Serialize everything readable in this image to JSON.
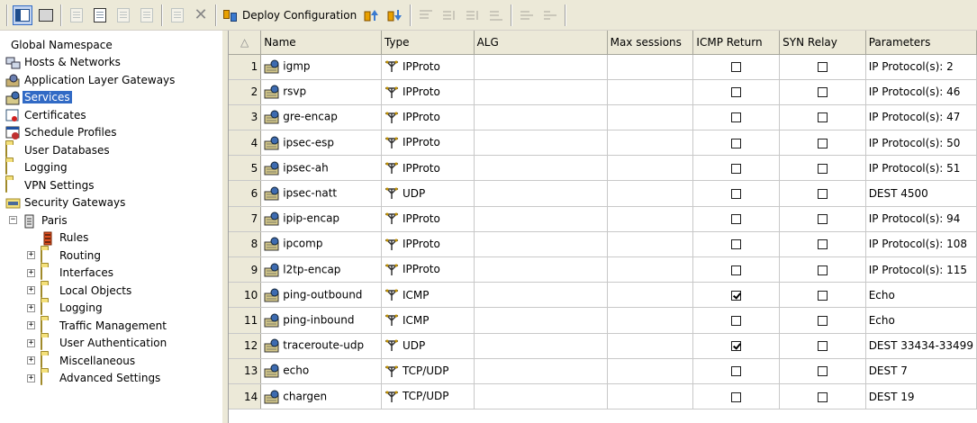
{
  "toolbar": {
    "deploy_label": "Deploy Configuration"
  },
  "tree": {
    "root": "Global Namespace",
    "items": [
      {
        "label": "Hosts & Networks",
        "icon": "hosts-networks-icon"
      },
      {
        "label": "Application Layer Gateways",
        "icon": "alg-icon"
      },
      {
        "label": "Services",
        "icon": "services-icon",
        "selected": true
      },
      {
        "label": "Certificates",
        "icon": "certificate-icon"
      },
      {
        "label": "Schedule Profiles",
        "icon": "schedule-icon"
      },
      {
        "label": "User Databases",
        "icon": "folder-icon"
      },
      {
        "label": "Logging",
        "icon": "folder-icon"
      },
      {
        "label": "VPN Settings",
        "icon": "folder-icon"
      },
      {
        "label": "Security Gateways",
        "icon": "gateway-folder-icon"
      }
    ],
    "gateway": "Paris",
    "gateway_children": [
      {
        "label": "Rules",
        "icon": "rules-icon",
        "expandable": false
      },
      {
        "label": "Routing",
        "icon": "folder-icon",
        "expandable": true
      },
      {
        "label": "Interfaces",
        "icon": "folder-icon",
        "expandable": true
      },
      {
        "label": "Local Objects",
        "icon": "folder-icon",
        "expandable": true
      },
      {
        "label": "Logging",
        "icon": "folder-icon",
        "expandable": true
      },
      {
        "label": "Traffic Management",
        "icon": "folder-icon",
        "expandable": true
      },
      {
        "label": "User Authentication",
        "icon": "folder-icon",
        "expandable": true
      },
      {
        "label": "Miscellaneous",
        "icon": "folder-icon",
        "expandable": true
      },
      {
        "label": "Advanced Settings",
        "icon": "folder-icon",
        "expandable": true
      }
    ],
    "expand_symbol": "+",
    "collapse_symbol": "−"
  },
  "table": {
    "sort_indicator": "△",
    "columns": [
      "Name",
      "Type",
      "ALG",
      "Max sessions",
      "ICMP Return",
      "SYN Relay",
      "Parameters"
    ],
    "rows": [
      {
        "n": "1",
        "name": "igmp",
        "type": "IPProto",
        "alg": "",
        "max": "",
        "icmp": false,
        "syn": false,
        "params": "IP Protocol(s): 2"
      },
      {
        "n": "2",
        "name": "rsvp",
        "type": "IPProto",
        "alg": "",
        "max": "",
        "icmp": false,
        "syn": false,
        "params": "IP Protocol(s): 46"
      },
      {
        "n": "3",
        "name": "gre-encap",
        "type": "IPProto",
        "alg": "",
        "max": "",
        "icmp": false,
        "syn": false,
        "params": "IP Protocol(s): 47"
      },
      {
        "n": "4",
        "name": "ipsec-esp",
        "type": "IPProto",
        "alg": "",
        "max": "",
        "icmp": false,
        "syn": false,
        "params": "IP Protocol(s): 50"
      },
      {
        "n": "5",
        "name": "ipsec-ah",
        "type": "IPProto",
        "alg": "",
        "max": "",
        "icmp": false,
        "syn": false,
        "params": "IP Protocol(s): 51"
      },
      {
        "n": "6",
        "name": "ipsec-natt",
        "type": "UDP",
        "alg": "",
        "max": "",
        "icmp": false,
        "syn": false,
        "params": "DEST 4500"
      },
      {
        "n": "7",
        "name": "ipip-encap",
        "type": "IPProto",
        "alg": "",
        "max": "",
        "icmp": false,
        "syn": false,
        "params": "IP Protocol(s): 94"
      },
      {
        "n": "8",
        "name": "ipcomp",
        "type": "IPProto",
        "alg": "",
        "max": "",
        "icmp": false,
        "syn": false,
        "params": "IP Protocol(s): 108"
      },
      {
        "n": "9",
        "name": "l2tp-encap",
        "type": "IPProto",
        "alg": "",
        "max": "",
        "icmp": false,
        "syn": false,
        "params": "IP Protocol(s): 115"
      },
      {
        "n": "10",
        "name": "ping-outbound",
        "type": "ICMP",
        "alg": "",
        "max": "",
        "icmp": true,
        "syn": false,
        "params": "Echo"
      },
      {
        "n": "11",
        "name": "ping-inbound",
        "type": "ICMP",
        "alg": "",
        "max": "",
        "icmp": false,
        "syn": false,
        "params": "Echo"
      },
      {
        "n": "12",
        "name": "traceroute-udp",
        "type": "UDP",
        "alg": "",
        "max": "",
        "icmp": true,
        "syn": false,
        "params": "DEST 33434-33499"
      },
      {
        "n": "13",
        "name": "echo",
        "type": "TCP/UDP",
        "alg": "",
        "max": "",
        "icmp": false,
        "syn": false,
        "params": "DEST 7"
      },
      {
        "n": "14",
        "name": "chargen",
        "type": "TCP/UDP",
        "alg": "",
        "max": "",
        "icmp": false,
        "syn": false,
        "params": "DEST 19"
      }
    ]
  },
  "colors": {
    "selection": "#316ac5",
    "chrome": "#ece9d8",
    "folder": "#f4e07a"
  }
}
